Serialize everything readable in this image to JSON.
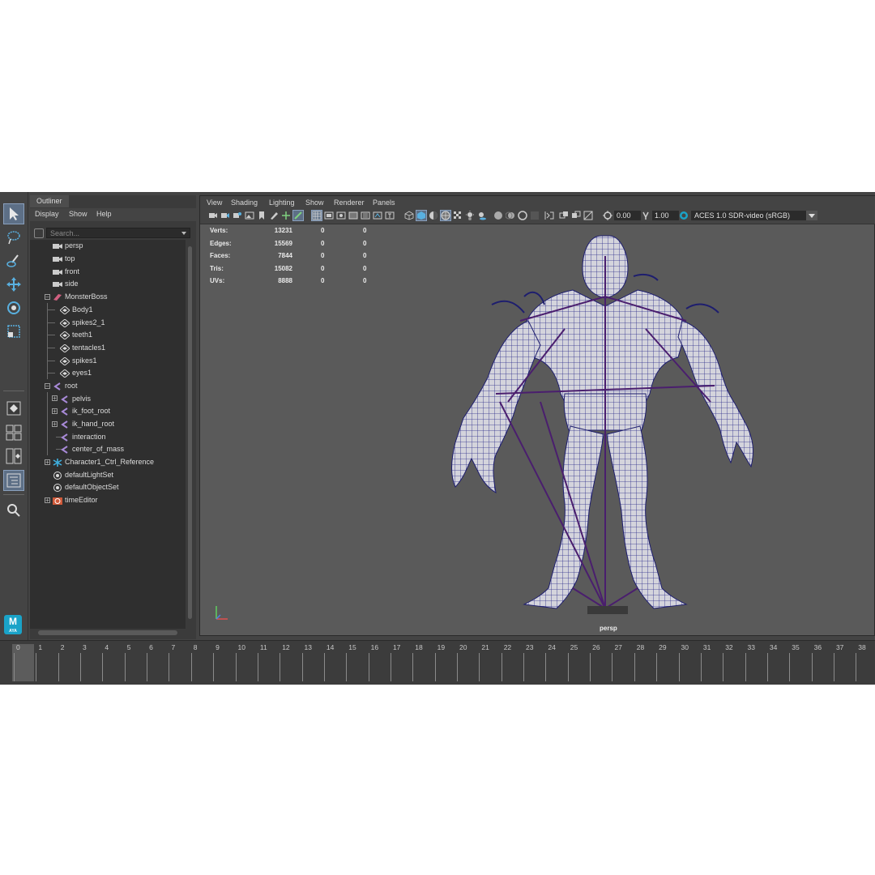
{
  "outliner": {
    "tab": "Outliner",
    "menu": [
      "Display",
      "Show",
      "Help"
    ],
    "search_placeholder": "Search...",
    "items": [
      {
        "label": "persp",
        "icon": "camera-icon"
      },
      {
        "label": "top",
        "icon": "camera-icon"
      },
      {
        "label": "front",
        "icon": "camera-icon"
      },
      {
        "label": "side",
        "icon": "camera-icon"
      },
      {
        "label": "MonsterBoss",
        "icon": "group-icon"
      },
      {
        "label": "Body1",
        "icon": "mesh-icon"
      },
      {
        "label": "spikes2_1",
        "icon": "mesh-icon"
      },
      {
        "label": "teeth1",
        "icon": "mesh-icon"
      },
      {
        "label": "tentacles1",
        "icon": "mesh-icon"
      },
      {
        "label": "spikes1",
        "icon": "mesh-icon"
      },
      {
        "label": "eyes1",
        "icon": "mesh-icon"
      },
      {
        "label": "root",
        "icon": "joint-icon"
      },
      {
        "label": "pelvis",
        "icon": "joint-icon"
      },
      {
        "label": "ik_foot_root",
        "icon": "joint-icon"
      },
      {
        "label": "ik_hand_root",
        "icon": "joint-icon"
      },
      {
        "label": "interaction",
        "icon": "joint-icon"
      },
      {
        "label": "center_of_mass",
        "icon": "joint-icon"
      },
      {
        "label": "Character1_Ctrl_Reference",
        "icon": "hik-icon"
      },
      {
        "label": "defaultLightSet",
        "icon": "set-icon"
      },
      {
        "label": "defaultObjectSet",
        "icon": "set-icon"
      },
      {
        "label": "timeEditor",
        "icon": "time-editor-icon"
      }
    ]
  },
  "viewport": {
    "menu": [
      "View",
      "Shading",
      "Lighting",
      "Show",
      "Renderer",
      "Panels"
    ],
    "exposure": "0.00",
    "gamma": "1.00",
    "color_space": "ACES 1.0 SDR-video (sRGB)",
    "camera": "persp",
    "hud": [
      {
        "label": "Verts:",
        "v1": "13231",
        "v2": "0",
        "v3": "0"
      },
      {
        "label": "Edges:",
        "v1": "15569",
        "v2": "0",
        "v3": "0"
      },
      {
        "label": "Faces:",
        "v1": "7844",
        "v2": "0",
        "v3": "0"
      },
      {
        "label": "Tris:",
        "v1": "15082",
        "v2": "0",
        "v3": "0"
      },
      {
        "label": "UVs:",
        "v1": "8888",
        "v2": "0",
        "v3": "0"
      }
    ]
  },
  "logo": {
    "letter": "M",
    "text": "AYA"
  },
  "timeline": {
    "frames": [
      "0",
      "1",
      "2",
      "3",
      "4",
      "5",
      "6",
      "7",
      "8",
      "9",
      "10",
      "11",
      "12",
      "13",
      "14",
      "15",
      "16",
      "17",
      "18",
      "19",
      "20",
      "21",
      "22",
      "23",
      "24",
      "25",
      "26",
      "27",
      "28",
      "29",
      "30",
      "31",
      "32",
      "33",
      "34",
      "35",
      "36",
      "37",
      "38"
    ],
    "current_frame": 0
  },
  "colors": {
    "panel": "#444444",
    "viewport_bg": "#5a5a5a",
    "wire": "#2a2a8a",
    "highlight": "#5d6f86"
  }
}
